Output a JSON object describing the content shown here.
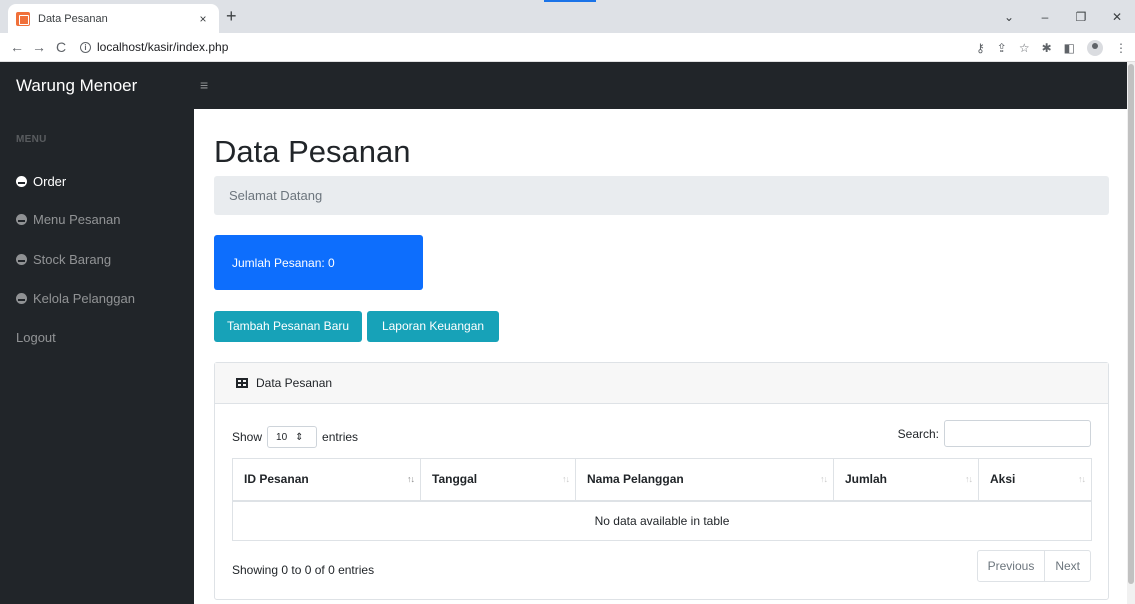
{
  "browser": {
    "tab_title": "Data Pesanan",
    "tab_close": "×",
    "new_tab": "+",
    "url": "localhost/kasir/index.php",
    "nav": {
      "back": "←",
      "forward": "→",
      "reload": "C",
      "info": "i"
    },
    "controls": {
      "tab_list": "⌄",
      "minimize": "–",
      "restore": "❐",
      "close": "✕"
    }
  },
  "app": {
    "brand": "Warung Menoer",
    "toggle_icon": "≡"
  },
  "sidebar": {
    "heading": "MENU",
    "items": [
      {
        "label": "Order",
        "active": true
      },
      {
        "label": "Menu Pesanan",
        "active": false
      },
      {
        "label": "Stock Barang",
        "active": false
      },
      {
        "label": "Kelola Pelanggan",
        "active": false
      },
      {
        "label": "Logout",
        "active": false
      }
    ]
  },
  "main": {
    "title": "Data Pesanan",
    "breadcrumb": "Selamat Datang",
    "stat_card": "Jumlah Pesanan: 0",
    "buttons": {
      "new_order": "Tambah Pesanan Baru",
      "report": "Laporan Keuangan"
    },
    "card": {
      "header": "Data Pesanan",
      "length": {
        "show": "Show",
        "value": "10",
        "entries": "entries"
      },
      "search_label": "Search:",
      "columns": [
        "ID Pesanan",
        "Tanggal",
        "Nama Pelanggan",
        "Jumlah",
        "Aksi"
      ],
      "sort_glyph": "↑↓",
      "empty_text": "No data available in table",
      "info": "Showing 0 to 0 of 0 entries",
      "pager": {
        "previous": "Previous",
        "next": "Next"
      }
    }
  },
  "colors": {
    "navbar": "#212529",
    "primary": "#0d6efd",
    "info": "#17a2b8"
  }
}
